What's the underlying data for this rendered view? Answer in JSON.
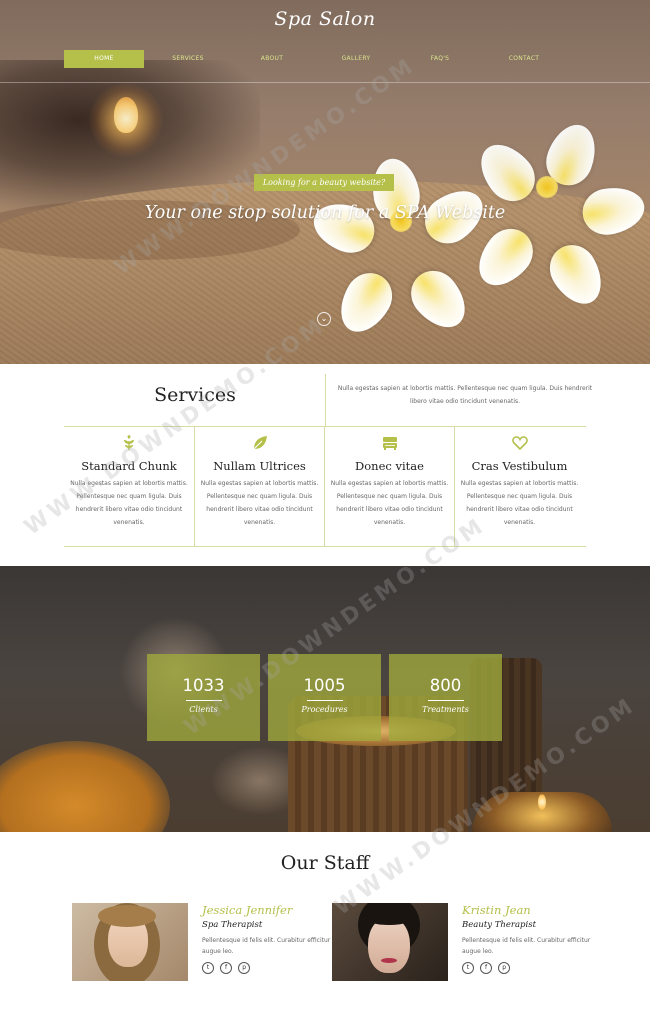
{
  "site": {
    "title": "Spa Salon"
  },
  "nav": {
    "items": [
      {
        "label": "Home",
        "active": true
      },
      {
        "label": "Services",
        "active": false
      },
      {
        "label": "About",
        "active": false
      },
      {
        "label": "Gallery",
        "active": false
      },
      {
        "label": "Faq's",
        "active": false
      },
      {
        "label": "Contact",
        "active": false
      }
    ]
  },
  "hero": {
    "tag": "Looking for a beauty website?",
    "heading": "Your one stop solution for a SPA Website",
    "scroll_icon": "chevron-down-icon"
  },
  "services": {
    "title": "Services",
    "intro": "Nulla egestas sapien at lobortis mattis. Pellentesque nec quam ligula. Duis hendrerit libero vitae odio tincidunt venenatis.",
    "items": [
      {
        "icon": "leaf-sprout-icon",
        "name": "Standard Chunk",
        "text": "Nulla egestas sapien at lobortis mattis. Pellentesque nec quam ligula. Duis hendrerit libero vitae odio tincidunt venenatis."
      },
      {
        "icon": "leaf-icon",
        "name": "Nullam Ultrices",
        "text": "Nulla egestas sapien at lobortis mattis. Pellentesque nec quam ligula. Duis hendrerit libero vitae odio tincidunt venenatis."
      },
      {
        "icon": "bed-icon",
        "name": "Donec vitae",
        "text": "Nulla egestas sapien at lobortis mattis. Pellentesque nec quam ligula. Duis hendrerit libero vitae odio tincidunt venenatis."
      },
      {
        "icon": "heart-icon",
        "name": "Cras Vestibulum",
        "text": "Nulla egestas sapien at lobortis mattis. Pellentesque nec quam ligula. Duis hendrerit libero vitae odio tincidunt venenatis."
      }
    ]
  },
  "stats": {
    "items": [
      {
        "value": "1033",
        "label": "Clients"
      },
      {
        "value": "1005",
        "label": "Procedures"
      },
      {
        "value": "800",
        "label": "Treatments"
      }
    ]
  },
  "staff": {
    "title": "Our Staff",
    "members": [
      {
        "name": "Jessica Jennifer",
        "role": "Spa Therapist",
        "bio": "Pellentesque id felis elit. Curabitur efficitur augue leo.",
        "socials": [
          "twitter-icon",
          "facebook-icon",
          "pinterest-icon"
        ]
      },
      {
        "name": "Kristin Jean",
        "role": "Beauty Therapist",
        "bio": "Pellentesque id felis elit. Curabitur efficitur augue leo.",
        "socials": [
          "twitter-icon",
          "facebook-icon",
          "pinterest-icon"
        ]
      }
    ]
  },
  "watermark": {
    "text": "WWW.DOWNDEMO.COM"
  },
  "colors": {
    "accent": "#b5c04a",
    "rule": "#d6dca4",
    "heading": "#222222",
    "body_text": "#666666"
  }
}
